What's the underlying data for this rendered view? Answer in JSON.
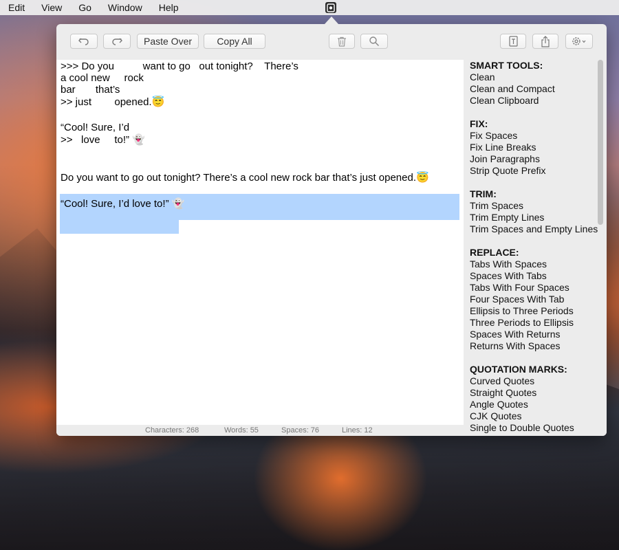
{
  "menubar": {
    "items": [
      "Edit",
      "View",
      "Go",
      "Window",
      "Help"
    ]
  },
  "toolbar": {
    "paste_over_label": "Paste Over",
    "copy_all_label": "Copy All"
  },
  "editor": {
    "original_lines": [
      ">>> Do you          want to go   out tonight?    There’s",
      "a cool new     rock",
      "bar       that’s",
      ">> just        opened.😇",
      "“Cool! Sure, I’d",
      ">>   love     to!” 👻"
    ],
    "cleaned_lines": [
      "Do you want to go out tonight? There’s a cool new rock bar that’s just opened.😇",
      "“Cool! Sure, I’d love to!” 👻"
    ]
  },
  "sidebar": {
    "groups": [
      {
        "header": "SMART TOOLS:",
        "items": [
          "Clean",
          "Clean and Compact",
          "Clean Clipboard"
        ]
      },
      {
        "header": "FIX:",
        "items": [
          "Fix Spaces",
          "Fix Line Breaks",
          "Join Paragraphs",
          "Strip Quote Prefix"
        ]
      },
      {
        "header": "TRIM:",
        "items": [
          "Trim Spaces",
          "Trim Empty Lines",
          "Trim Spaces and Empty Lines"
        ]
      },
      {
        "header": "REPLACE:",
        "items": [
          "Tabs With Spaces",
          "Spaces With Tabs",
          "Tabs With Four Spaces",
          "Four Spaces With Tab",
          "Ellipsis to Three Periods",
          "Three Periods to Ellipsis",
          "Spaces With Returns",
          "Returns With Spaces"
        ]
      },
      {
        "header": "QUOTATION MARKS:",
        "items": [
          "Curved Quotes",
          "Straight Quotes",
          "Angle Quotes",
          "CJK Quotes",
          "Single to Double Quotes"
        ]
      }
    ]
  },
  "statusbar": {
    "characters": "Characters: 268",
    "words": "Words: 55",
    "spaces": "Spaces: 76",
    "lines": "Lines: 12"
  },
  "colors": {
    "selection": "#b3d5fe",
    "window_bg": "#ececec"
  }
}
